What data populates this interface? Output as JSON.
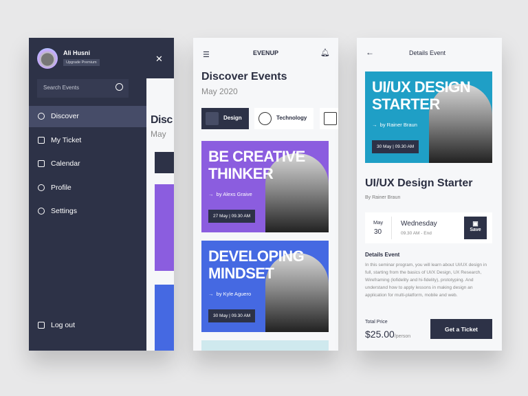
{
  "drawer": {
    "user_name": "Ali Husni",
    "badge": "Upgrade Premium",
    "search_placeholder": "Search Events",
    "items": [
      {
        "label": "Discover",
        "icon": "compass-icon",
        "active": true
      },
      {
        "label": "My Ticket",
        "icon": "ticket-icon"
      },
      {
        "label": "Calendar",
        "icon": "calendar-icon"
      },
      {
        "label": "Profile",
        "icon": "user-icon"
      },
      {
        "label": "Settings",
        "icon": "gear-icon"
      }
    ],
    "logout": "Log out",
    "peek_title": "Disc",
    "peek_sub": "May"
  },
  "discover": {
    "logo_a": "EVEN",
    "logo_b": "UP",
    "title": "Discover Events",
    "subtitle": "May 2020",
    "tabs": [
      {
        "label": "Design",
        "active": true
      },
      {
        "label": "Technology"
      }
    ],
    "events": [
      {
        "title1": "BE CREATIVE",
        "title2": "THINKER",
        "by": "by Alexs Graive",
        "date": "27 May",
        "time": "09.30 AM",
        "color": "#8b5ddf"
      },
      {
        "title1": "DEVELOPING",
        "title2": "MINDSET",
        "by": "by Kyle Aguero",
        "date": "30 May",
        "time": "09.30 AM",
        "color": "#4569e2"
      }
    ]
  },
  "details": {
    "header": "Details Event",
    "banner": {
      "title1": "UI/UX DESIGN",
      "title2": "STARTER",
      "by": "by Rainer Braun",
      "date": "30 May",
      "time": "09.30 AM",
      "color": "#1f9fc6"
    },
    "title": "UI/UX Design Starter",
    "author": "By Rainer Braun",
    "month": "May",
    "day": "30",
    "weekday": "Wednesday",
    "time_range": "09.30 AM - End",
    "save": "Save",
    "section": "Details Event",
    "description": "In this seminar program, you will learn about UI/UX design in full, starting from the basics of UI/X Design, UX Research, Wireframing (lofidelity and hi-fidelity), prototyping. And understand how to apply lessons in making design an application for multi-platform, mobile and web.",
    "price_label": "Total Price",
    "price": "$25.00",
    "per": "/person",
    "cta": "Get a Ticket"
  }
}
